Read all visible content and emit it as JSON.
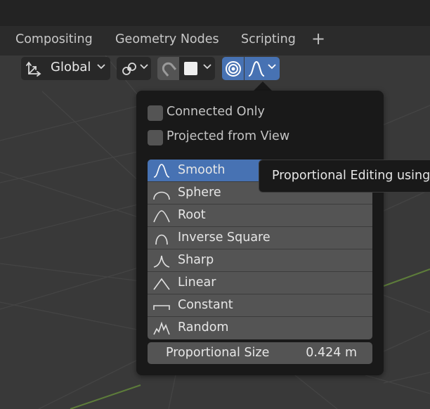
{
  "tabs": [
    {
      "label": "Compositing"
    },
    {
      "label": "Geometry Nodes"
    },
    {
      "label": "Scripting"
    }
  ],
  "add_tab_label": "+",
  "header": {
    "orientation_label": "Global",
    "orientation_icon": "transform-orientation-icon",
    "pivot_icon": "link-pivot-icon",
    "snap_icon": "magnet-icon",
    "proportional_icon": "proportional-editing-icon",
    "falloff_icon": "smooth-falloff-icon",
    "active_color": "#4772b3"
  },
  "popover": {
    "connected_only": {
      "label": "Connected Only",
      "checked": false
    },
    "projected_from_view": {
      "label": "Projected from View",
      "checked": false
    },
    "falloff_items": [
      {
        "label": "Smooth",
        "icon": "smooth-curve-icon",
        "selected": true
      },
      {
        "label": "Sphere",
        "icon": "sphere-curve-icon",
        "selected": false
      },
      {
        "label": "Root",
        "icon": "root-curve-icon",
        "selected": false
      },
      {
        "label": "Inverse Square",
        "icon": "inverse-square-curve-icon",
        "selected": false
      },
      {
        "label": "Sharp",
        "icon": "sharp-curve-icon",
        "selected": false
      },
      {
        "label": "Linear",
        "icon": "linear-curve-icon",
        "selected": false
      },
      {
        "label": "Constant",
        "icon": "constant-curve-icon",
        "selected": false
      },
      {
        "label": "Random",
        "icon": "random-curve-icon",
        "selected": false
      }
    ],
    "proportional_size": {
      "label": "Proportional Size",
      "value": "0.424 m"
    }
  },
  "tooltip": {
    "text": "Proportional Editing using"
  }
}
